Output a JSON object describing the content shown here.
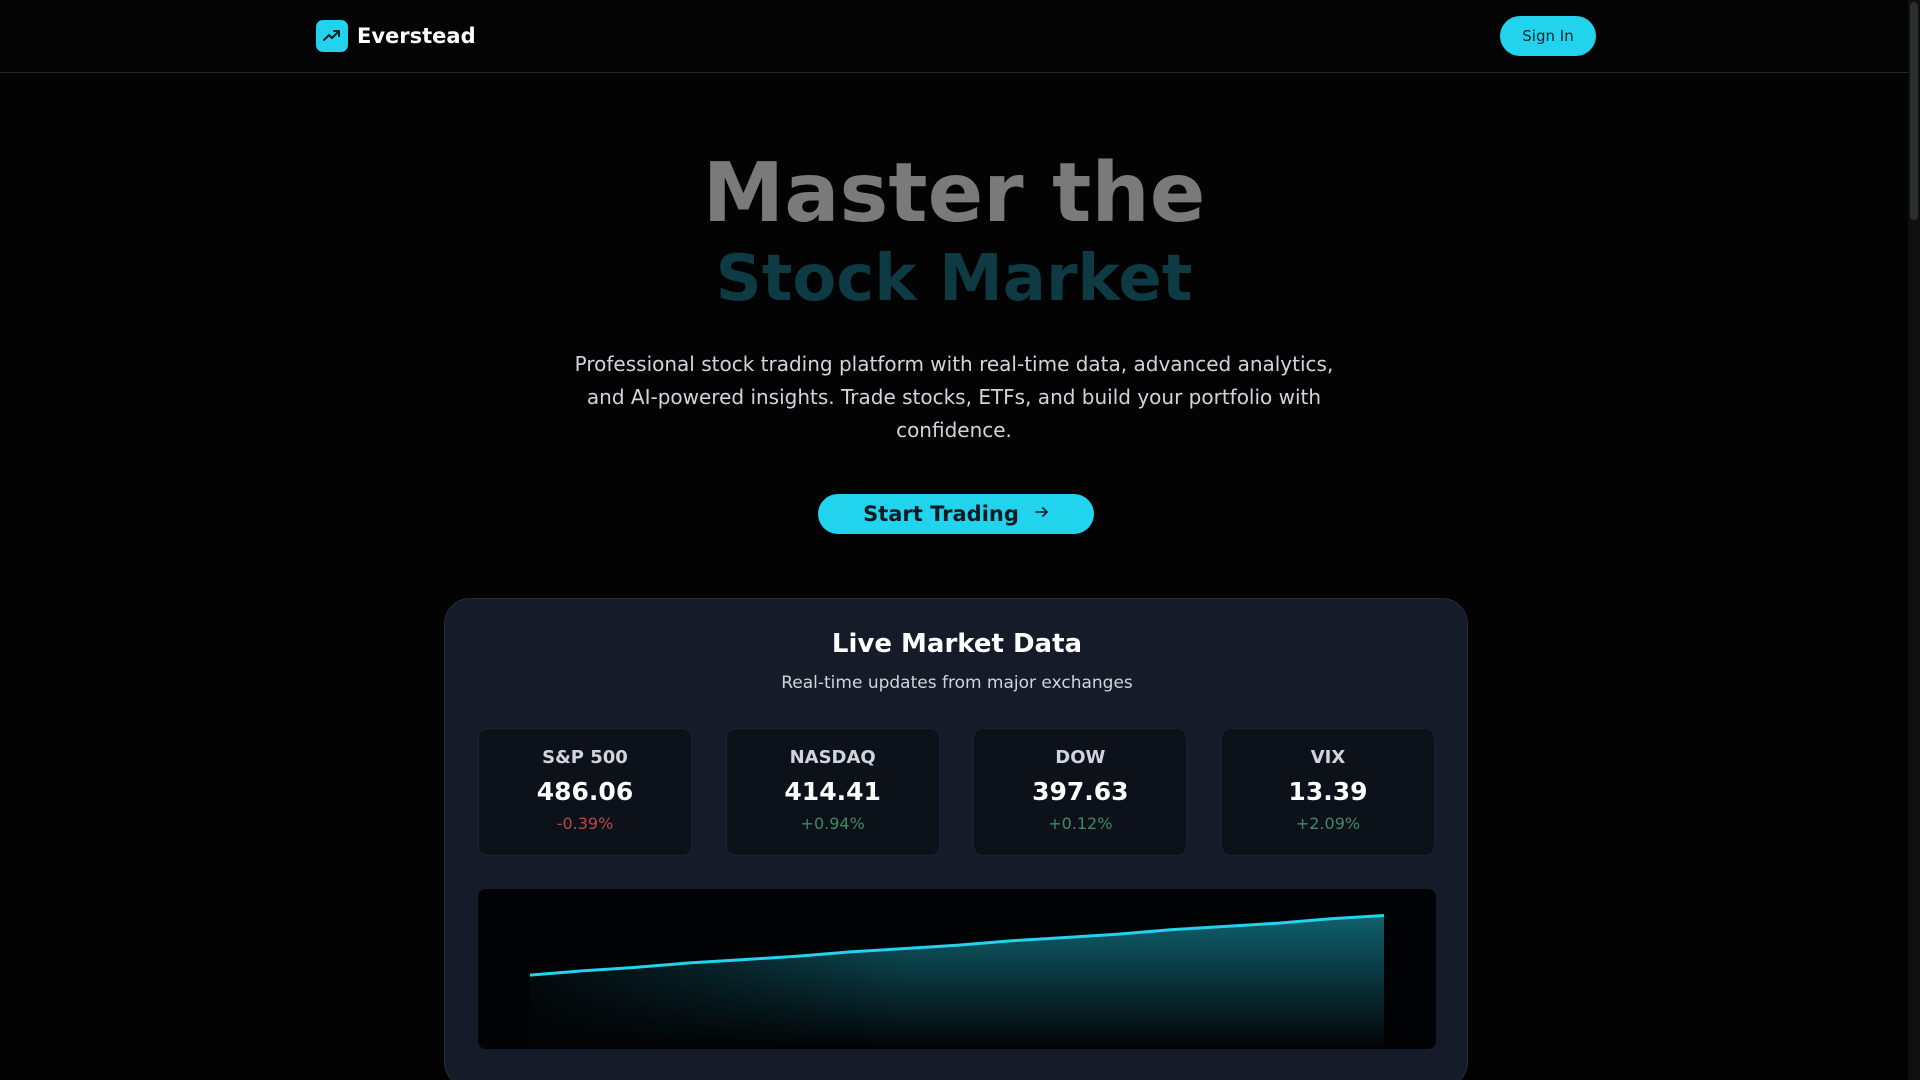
{
  "header": {
    "brand": "Everstead",
    "signin_label": "Sign In"
  },
  "hero": {
    "title_line1": "Master the",
    "title_line2": "Stock Market",
    "description": "Professional stock trading platform with real-time data, advanced analytics, and AI-powered insights. Trade stocks, ETFs, and build your portfolio with confidence.",
    "cta_label": "Start Trading",
    "cta_icon": "arrow-right-icon"
  },
  "market": {
    "title": "Live Market Data",
    "subtitle": "Real-time updates from major exchanges",
    "tiles": [
      {
        "name": "S&P 500",
        "value": "486.06",
        "change": "-0.39%",
        "direction": "down"
      },
      {
        "name": "NASDAQ",
        "value": "414.41",
        "change": "+0.94%",
        "direction": "up"
      },
      {
        "name": "DOW",
        "value": "397.63",
        "change": "+0.12%",
        "direction": "up"
      },
      {
        "name": "VIX",
        "value": "13.39",
        "change": "+2.09%",
        "direction": "up"
      }
    ]
  },
  "colors": {
    "accent": "#22d3ee",
    "negative": "#b24a4a",
    "positive": "#3e8a63",
    "card": "#151b28"
  },
  "chart_data": {
    "type": "area",
    "x": [
      0,
      1,
      2,
      3,
      4,
      5,
      6,
      7,
      8,
      9,
      10,
      11,
      12,
      13,
      14,
      15,
      16
    ],
    "values": [
      12,
      16,
      19,
      23,
      26,
      29,
      33,
      36,
      39,
      43,
      46,
      49,
      53,
      56,
      59,
      63,
      66
    ],
    "ylim": [
      -55,
      90
    ],
    "title": "",
    "xlabel": "",
    "ylabel": "",
    "grid": false,
    "legend": "none",
    "color": "#22d3ee"
  }
}
